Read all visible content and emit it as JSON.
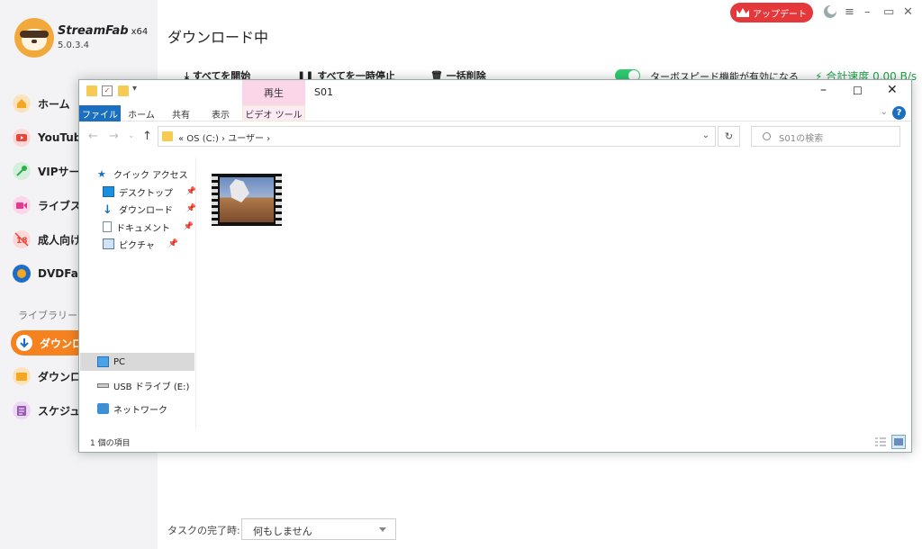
{
  "app": {
    "brand": "StreamFab",
    "arch": "x64",
    "version": "5.0.3.4",
    "upgrade_label": "アップデート",
    "page_title": "ダウンロード中"
  },
  "sidebar": {
    "items": [
      {
        "label": "ホーム",
        "color": "#f5a623"
      },
      {
        "label": "YouTube",
        "color": "#e8453c"
      },
      {
        "label": "VIPサービス",
        "color": "#2eae4f"
      },
      {
        "label": "ライブストリーム",
        "color": "#e23b8e"
      },
      {
        "label": "成人向け",
        "color": "#e8453c"
      },
      {
        "label": "DVDFab",
        "color": "#1d6cc9"
      }
    ],
    "library_label": "ライブラリー",
    "library_items": [
      {
        "label": "ダウンロード中",
        "color": "#f5821f"
      },
      {
        "label": "ダウンロード済み",
        "color": "#f5a623"
      },
      {
        "label": "スケジュール",
        "color": "#9b59b6"
      }
    ]
  },
  "toolbar": {
    "start_all": "すべてを開始",
    "pause_all": "すべてを一時停止",
    "delete_all": "一括削除",
    "turbo_label": "ターボスピード機能が有効になる",
    "turbo_on": true,
    "speed_label": "合計速度 0.00 B/s"
  },
  "footer": {
    "completion_label": "タスクの完了時:",
    "completion_value": "何もしません"
  },
  "explorer": {
    "play_tab": "再生",
    "window_title": "S01",
    "ribbon_tabs": [
      "ファイル",
      "ホーム",
      "共有",
      "表示",
      "ビデオ ツール"
    ],
    "address_path": "«  OS (C:)  ›  ユーザー  ›",
    "search_placeholder": "S01の検索",
    "nav": {
      "quick_access": "クイック アクセス",
      "desktop": "デスクトップ",
      "downloads": "ダウンロード",
      "documents": "ドキュメント",
      "pictures": "ピクチャ",
      "pc": "PC",
      "usb": "USB ドライブ (E:)",
      "network": "ネットワーク"
    },
    "status_text": "1 個の項目",
    "accent": "#1a6fc0"
  }
}
